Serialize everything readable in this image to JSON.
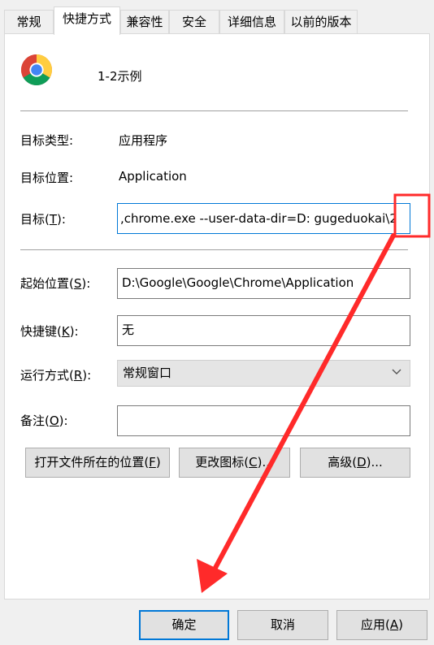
{
  "tabs": [
    {
      "label": "常规"
    },
    {
      "label": "快捷方式"
    },
    {
      "label": "兼容性"
    },
    {
      "label": "安全"
    },
    {
      "label": "详细信息"
    },
    {
      "label": "以前的版本"
    }
  ],
  "shortcut": {
    "name": "1-2示例",
    "icon": "chrome-icon"
  },
  "fields": {
    "type_label": "目标类型:",
    "type_value": "应用程序",
    "location_label": "目标位置:",
    "location_value": "Application",
    "target_label_prefix": "目标(",
    "target_label_key": "T",
    "target_label_suffix": "):",
    "target_value": ",chrome.exe --user-data-dir=D:  gugeduokai\\2",
    "startin_label_prefix": "起始位置(",
    "startin_label_key": "S",
    "startin_label_suffix": "):",
    "startin_value": "D:\\Google\\Google\\Chrome\\Application",
    "hotkey_label_prefix": "快捷键(",
    "hotkey_label_key": "K",
    "hotkey_label_suffix": "):",
    "hotkey_value": "无",
    "run_label_prefix": "运行方式(",
    "run_label_key": "R",
    "run_label_suffix": "):",
    "run_value": "常规窗口",
    "comment_label_prefix": "备注(",
    "comment_label_key": "O",
    "comment_label_suffix": "):",
    "comment_value": ""
  },
  "buttons": {
    "open_location_prefix": "打开文件所在的位置(",
    "open_location_key": "F",
    "open_location_suffix": ")",
    "change_icon_prefix": "更改图标(",
    "change_icon_key": "C",
    "change_icon_suffix": ")...",
    "advanced_prefix": "高级(",
    "advanced_key": "D",
    "advanced_suffix": ")...",
    "ok": "确定",
    "cancel": "取消",
    "apply_prefix": "应用(",
    "apply_key": "A",
    "apply_suffix": ")"
  },
  "colors": {
    "annotation": "#ff2a2a",
    "focus": "#0078d7"
  }
}
